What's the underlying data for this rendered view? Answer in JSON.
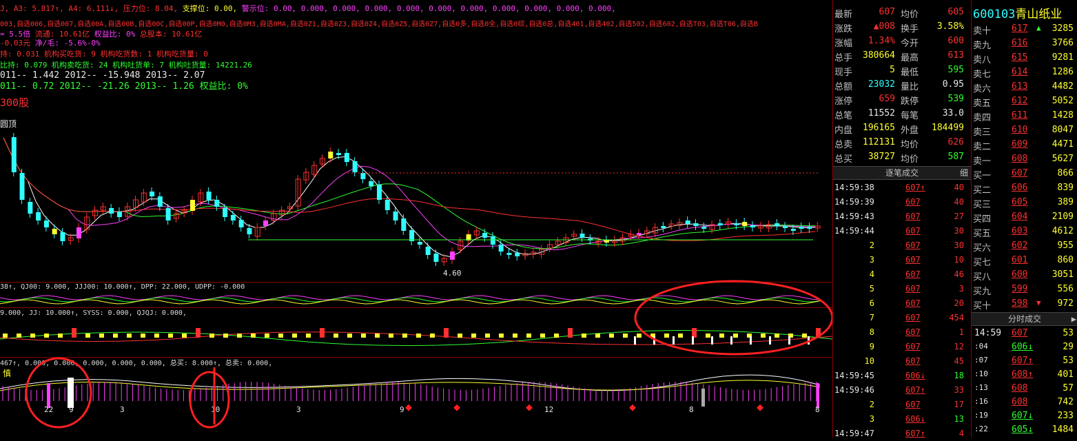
{
  "indicator_header": {
    "line1": [
      {
        "text": "J, A3: 5.817↑, A4: 6.111↓,",
        "color": "r"
      },
      {
        "text": " 压力位: 8.04,",
        "color": "r"
      },
      {
        "text": " 支撑位: 0.00,",
        "color": "y"
      },
      {
        "text": " 警示位: 0.00, 0.000, 0.000, 0.000, 0.000, 0.000, 0.000, 0.000, 0.000, 0.000, 0.000,",
        "color": "m"
      }
    ],
    "line2": "003,自选006,自选007,自选00A,自选00B,自选00C,自选00P,自选0M0,自选0M3,自选0MA,自选0Z1,自选0Z3,自选0Z4,自选0Z5,自选0Z7,自选0多,自选0全,自选0综,自选0总,自选401,自选402,自选502,自选602,自选T03,自选T06,自选B",
    "line3": [
      {
        "text": "= 5.5倍",
        "color": "m"
      },
      {
        "text": "      流通: 10.61亿",
        "color": "r"
      },
      {
        "text": "         权益比: 0%",
        "color": "m"
      },
      {
        "text": "            总股本: 10.61亿",
        "color": "r"
      }
    ],
    "line4": [
      {
        "text": "-0.03元",
        "color": "r"
      },
      {
        "text": "   净/毛: -5.6%-0%",
        "color": "m"
      }
    ],
    "line5": [
      {
        "text": "持: 0.031",
        "color": "r"
      },
      {
        "text": "      机构买吃货: 9",
        "color": "r"
      },
      {
        "text": "      机构吃货数: 1",
        "color": "r"
      },
      {
        "text": "      机构吃货量: 0",
        "color": "r"
      }
    ],
    "line6": [
      {
        "text": "比持: 0.079",
        "color": "g"
      },
      {
        "text": "      机构卖吃货: 24",
        "color": "g"
      },
      {
        "text": "     机构吐货单: 7",
        "color": "g"
      },
      {
        "text": "      机构吐货量: 14221.26",
        "color": "g"
      }
    ],
    "line7": "011-- 1.442    2012-- -15.948    2013-- 2.07",
    "line8": "011-- 0.72    2012-- -21.26    2013-- 1.26",
    "line8_extra": "    权益比: 0%",
    "section_label": "300股",
    "top_label": "圆顶",
    "price_low": "4.60"
  },
  "sub1_header": "38↑, QJ00: 9.000, JJJ00: 10.000↑, DPP: 22.000, UDPP: -0.000",
  "sub2_header": "9.000, JJ: 10.000↑, SYSS: 0.000, QJQJ: 0.000,",
  "sub3_header": "467↑, 0.000, 0.000, 0.000, 0.000, 0.000, 总买: 8.000↑, 总卖: 0.000,",
  "sub3_label": "慎",
  "bottom_numbers": [
    "22",
    "9",
    "3",
    "10",
    "3",
    "9",
    "12",
    "8",
    "8"
  ],
  "quote": {
    "code": "600103",
    "name": "青山纸业",
    "rows": [
      {
        "l1": "最新",
        "v1": "607",
        "c1": "r",
        "l2": "均价",
        "v2": "605",
        "c2": "r"
      },
      {
        "l1": "涨跌",
        "v1": "▲008",
        "c1": "r",
        "l2": "换手",
        "v2": "3.58%",
        "c2": "y"
      },
      {
        "l1": "涨幅",
        "v1": "1.34%",
        "c1": "r",
        "l2": "今开",
        "v2": "600",
        "c2": "r"
      },
      {
        "l1": "总手",
        "v1": "380664",
        "c1": "y",
        "l2": "最高",
        "v2": "613",
        "c2": "r"
      },
      {
        "l1": "现手",
        "v1": "5",
        "c1": "y",
        "l2": "最低",
        "v2": "595",
        "c2": "g"
      },
      {
        "l1": "总额",
        "v1": "23032",
        "c1": "c",
        "l2": "量比",
        "v2": "0.95",
        "c2": "w"
      },
      {
        "l1": "涨停",
        "v1": "659",
        "c1": "r",
        "l2": "跌停",
        "v2": "539",
        "c2": "g"
      },
      {
        "l1": "总笔",
        "v1": "11552",
        "c1": "w",
        "l2": "每笔",
        "v2": "33.0",
        "c2": "w"
      },
      {
        "l1": "内盘",
        "v1": "196165",
        "c1": "y",
        "l2": "外盘",
        "v2": "184499",
        "c2": "y"
      },
      {
        "l1": "总卖",
        "v1": "112131",
        "c1": "y",
        "l2": "均价",
        "v2": "626",
        "c2": "r"
      },
      {
        "l1": "总买",
        "v1": "38727",
        "c1": "y",
        "l2": "均价",
        "v2": "587",
        "c2": "g"
      }
    ],
    "tick_header": "逐笔成交",
    "tick_btn": "细",
    "ticks": [
      {
        "t": "14:59:38",
        "p": "607↑",
        "pc": "r",
        "v": "40",
        "vc": "r"
      },
      {
        "t": "14:59:39",
        "p": "607",
        "pc": "r",
        "v": "40",
        "vc": "r"
      },
      {
        "t": "14:59:43",
        "p": "607",
        "pc": "r",
        "v": "27",
        "vc": "r"
      },
      {
        "t": "14:59:44",
        "p": "607",
        "pc": "r",
        "v": "30",
        "vc": "r"
      },
      {
        "t": "2",
        "p": "607",
        "pc": "r",
        "v": "30",
        "vc": "r"
      },
      {
        "t": "3",
        "p": "607",
        "pc": "r",
        "v": "10",
        "vc": "r"
      },
      {
        "t": "4",
        "p": "607",
        "pc": "r",
        "v": "46",
        "vc": "r"
      },
      {
        "t": "5",
        "p": "607",
        "pc": "r",
        "v": "3",
        "vc": "r"
      },
      {
        "t": "6",
        "p": "607",
        "pc": "r",
        "v": "20",
        "vc": "r"
      },
      {
        "t": "7",
        "p": "607",
        "pc": "r",
        "v": "454",
        "vc": "r"
      },
      {
        "t": "8",
        "p": "607",
        "pc": "r",
        "v": "1",
        "vc": "r"
      },
      {
        "t": "9",
        "p": "607",
        "pc": "r",
        "v": "12",
        "vc": "r"
      },
      {
        "t": "10",
        "p": "607",
        "pc": "r",
        "v": "45",
        "vc": "r"
      },
      {
        "t": "14:59:45",
        "p": "606↓",
        "pc": "r",
        "v": "18",
        "vc": "g"
      },
      {
        "t": "14:59:46",
        "p": "607↑",
        "pc": "r",
        "v": "33",
        "vc": "r"
      },
      {
        "t": "2",
        "p": "607",
        "pc": "r",
        "v": "17",
        "vc": "r"
      },
      {
        "t": "3",
        "p": "606↓",
        "pc": "r",
        "v": "13",
        "vc": "g"
      },
      {
        "t": "14:59:47",
        "p": "607↑",
        "pc": "r",
        "v": "4",
        "vc": "r"
      }
    ]
  },
  "orders": {
    "title": "600103",
    "name": "青山纸业",
    "rows": [
      {
        "l": "卖十",
        "p": "617",
        "a": "▲",
        "ac": "g",
        "v": "3285"
      },
      {
        "l": "卖九",
        "p": "616",
        "a": "",
        "ac": "",
        "v": "3766"
      },
      {
        "l": "卖八",
        "p": "615",
        "a": "",
        "ac": "",
        "v": "9281"
      },
      {
        "l": "卖七",
        "p": "614",
        "a": "",
        "ac": "",
        "v": "1286"
      },
      {
        "l": "卖六",
        "p": "613",
        "a": "",
        "ac": "",
        "v": "4482"
      },
      {
        "l": "卖五",
        "p": "612",
        "a": "",
        "ac": "",
        "v": "5052"
      },
      {
        "l": "卖四",
        "p": "611",
        "a": "",
        "ac": "",
        "v": "1428"
      },
      {
        "l": "卖三",
        "p": "610",
        "a": "",
        "ac": "",
        "v": "8047"
      },
      {
        "l": "卖二",
        "p": "609",
        "a": "",
        "ac": "",
        "v": "4471"
      },
      {
        "l": "卖一",
        "p": "608",
        "a": "",
        "ac": "",
        "v": "5627"
      },
      {
        "l": "买一",
        "p": "607",
        "a": "",
        "ac": "",
        "v": "866"
      },
      {
        "l": "买二",
        "p": "606",
        "a": "",
        "ac": "",
        "v": "839"
      },
      {
        "l": "买三",
        "p": "605",
        "a": "",
        "ac": "",
        "v": "389"
      },
      {
        "l": "买四",
        "p": "604",
        "a": "",
        "ac": "",
        "v": "2109"
      },
      {
        "l": "买五",
        "p": "603",
        "a": "",
        "ac": "",
        "v": "4612"
      },
      {
        "l": "买六",
        "p": "602",
        "a": "",
        "ac": "",
        "v": "955"
      },
      {
        "l": "买七",
        "p": "601",
        "a": "",
        "ac": "",
        "v": "860"
      },
      {
        "l": "买八",
        "p": "600",
        "a": "",
        "ac": "",
        "v": "3051"
      },
      {
        "l": "买九",
        "p": "599",
        "a": "",
        "ac": "",
        "v": "556"
      },
      {
        "l": "买十",
        "p": "598",
        "a": "▼",
        "ac": "r",
        "v": "972"
      }
    ],
    "ts_header": "分时成交",
    "ts": [
      {
        "t": "14:59",
        "p": "607",
        "pc": "r",
        "v": "53"
      },
      {
        "t": ":04",
        "p": "606↓",
        "pc": "g",
        "v": "29"
      },
      {
        "t": ":07",
        "p": "607↑",
        "pc": "r",
        "v": "53"
      },
      {
        "t": ":10",
        "p": "608↑",
        "pc": "r",
        "v": "401"
      },
      {
        "t": ":13",
        "p": "608",
        "pc": "r",
        "v": "57"
      },
      {
        "t": ":16",
        "p": "608",
        "pc": "r",
        "v": "742"
      },
      {
        "t": ":19",
        "p": "607↓",
        "pc": "g",
        "v": "233"
      },
      {
        "t": ":22",
        "p": "605↓",
        "pc": "g",
        "v": "1484"
      }
    ]
  },
  "colors": {
    "up": "#ff3030",
    "down": "#30ffff",
    "ma5": "#ffffff",
    "ma10": "#ff40ff",
    "ma20": "#30ff30",
    "ma60": "#ff3030"
  }
}
